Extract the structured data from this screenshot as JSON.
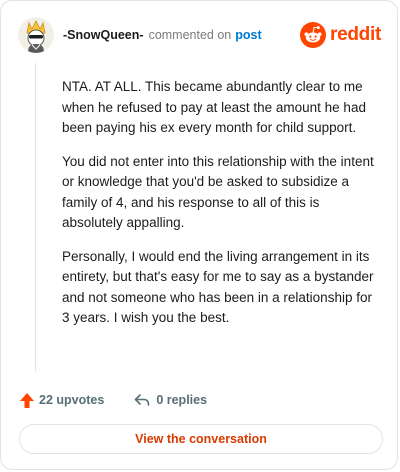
{
  "comment": {
    "username": "-SnowQueen-",
    "action_text": "commented on",
    "post_link_text": "post",
    "paragraphs": [
      "NTA. AT ALL. This became abundantly clear to me when he refused to pay at least the amount he had been paying his ex every month for child support.",
      "You did not enter into this relationship with the intent or knowledge that you'd be asked to subsidize a family of 4, and his response to all of this is absolutely appalling.",
      "Personally, I would end the living arrangement in its entirety, but that's easy for me to say as a bystander and not someone who has been in a relationship for 3 years. I wish you the best."
    ],
    "upvotes_label": "22 upvotes",
    "replies_label": "0 replies"
  },
  "brand": {
    "wordmark": "reddit",
    "color": "#ff4500"
  },
  "footer": {
    "view_conversation_label": "View the conversation"
  },
  "colors": {
    "link_blue": "#0079d3",
    "upvote_orange": "#ff4500",
    "button_text": "#d93a00"
  }
}
